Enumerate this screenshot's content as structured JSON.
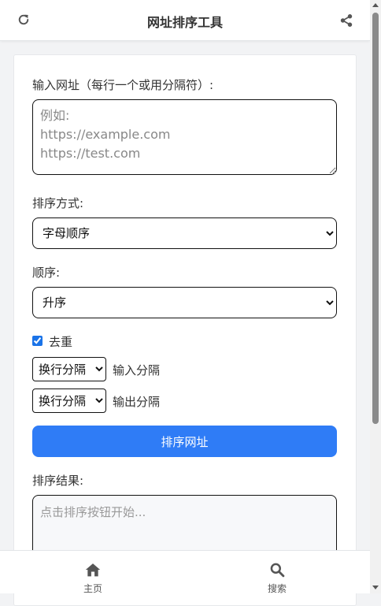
{
  "header": {
    "title": "网址排序工具",
    "icons": [
      "refresh-icon",
      "share-icon"
    ]
  },
  "form": {
    "input_label": "输入网址（每行一个或用分隔符）:",
    "input_placeholder": "例如:\nhttps://example.com\nhttps://test.com",
    "input_value": "",
    "sort_method_label": "排序方式:",
    "sort_method_selected": "字母顺序",
    "order_label": "顺序:",
    "order_selected": "升序",
    "dedupe_label": "去重",
    "dedupe_checked": true,
    "input_separator_selected": "换行分隔",
    "input_separator_label": "输入分隔",
    "output_separator_selected": "换行分隔",
    "output_separator_label": "输出分隔",
    "sort_button_label": "排序网址",
    "result_label": "排序结果:",
    "result_placeholder": "点击排序按钮开始..."
  },
  "bottom_nav": {
    "items": [
      {
        "label": "主页",
        "icon": "home-icon"
      },
      {
        "label": "搜索",
        "icon": "search-icon"
      }
    ]
  },
  "colors": {
    "accent": "#2f7cf6",
    "checkbox": "#1a73e8",
    "page_background": "#f2f3f5",
    "card_background": "#ffffff"
  }
}
